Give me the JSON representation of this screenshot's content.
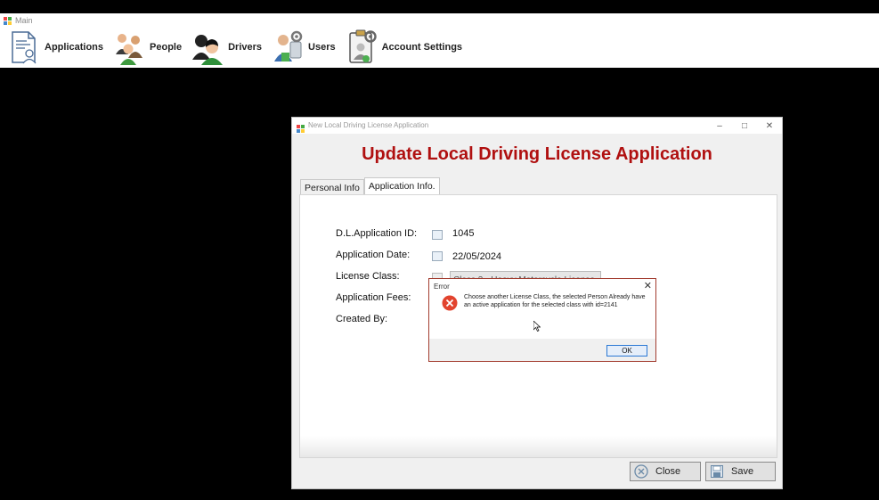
{
  "main": {
    "title": "Main",
    "menu": [
      {
        "label": "Applications",
        "icon": "document-user-icon"
      },
      {
        "label": "People",
        "icon": "people-icon"
      },
      {
        "label": "Drivers",
        "icon": "drivers-icon"
      },
      {
        "label": "Users",
        "icon": "users-gear-icon"
      },
      {
        "label": "Account Settings",
        "icon": "account-settings-icon"
      }
    ]
  },
  "dialog": {
    "title": "New Local Driving License Application",
    "heading": "Update Local Driving License Application",
    "heading_color": "#b01010",
    "tabs": [
      {
        "label": "Personal Info",
        "active": false
      },
      {
        "label": "Application Info.",
        "active": true
      }
    ],
    "fields": {
      "app_id_label": "D.L.Application ID:",
      "app_id_value": "1045",
      "app_date_label": "Application Date:",
      "app_date_value": "22/05/2024",
      "license_class_label": "License Class:",
      "license_class_value": "Class 3 - Heavy Motorcycle License",
      "fees_label": "Application Fees:",
      "created_by_label": "Created By:"
    },
    "buttons": {
      "close_label": "Close",
      "save_label": "Save"
    }
  },
  "error": {
    "title": "Error",
    "message": "Choose another License Class, the selected Person Already have an active application for the selected class with id=2141",
    "ok_label": "OK",
    "border_color": "#a23c2f"
  }
}
